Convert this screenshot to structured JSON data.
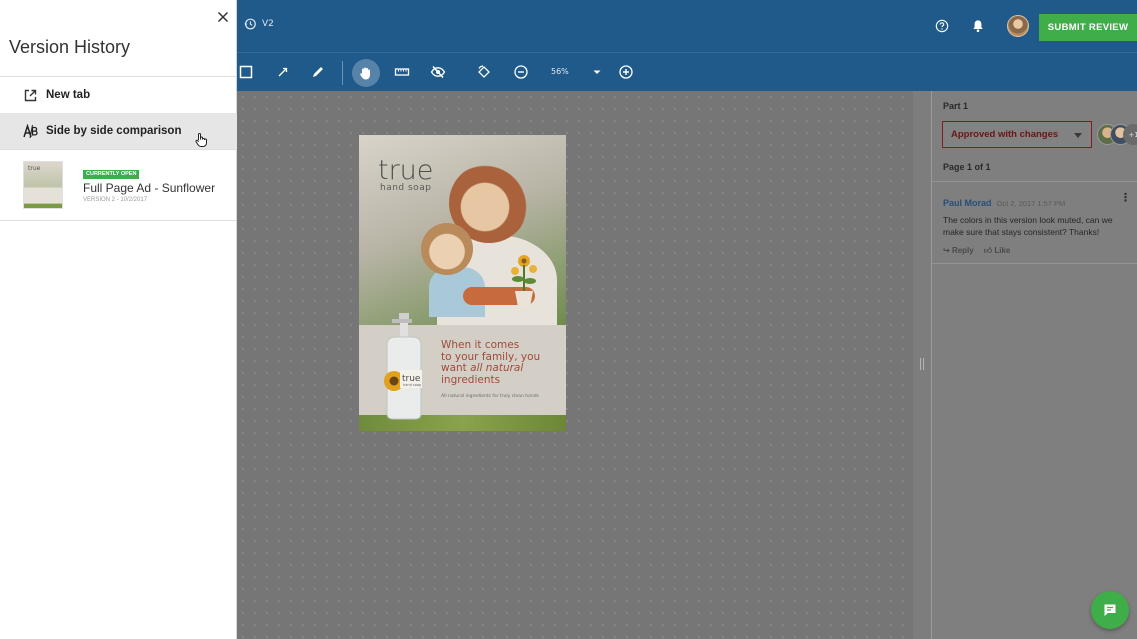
{
  "header": {
    "version_label": "V2",
    "submit_label": "SUBMIT REVIEW"
  },
  "toolbar": {
    "zoom_level": "56%",
    "tools": [
      "rectangle-tool",
      "arrow-tool",
      "pen-tool",
      "hand-tool",
      "ruler-tool",
      "hide-annotations-tool",
      "rotate-tool",
      "zoom-out",
      "zoom-in"
    ],
    "active_tool": "hand-tool"
  },
  "ad": {
    "brand": "true",
    "brand_sub": "hand soap",
    "tagline_line1": "When it comes",
    "tagline_line2": "to your family, you",
    "tagline_want": "want ",
    "tagline_em": "all natural",
    "tagline_line4": "ingredients",
    "fine_print": "All natural ingredients for truly clean hands",
    "bottle_brand": "true",
    "bottle_sub": "hand soap"
  },
  "review_panel": {
    "part_label": "Part 1",
    "status": "Approved with changes",
    "extra_reviewers": "+1",
    "page_label": "Page 1 of 1",
    "comment": {
      "author": "Paul Morad",
      "time": "Oct 2, 2017 1:57 PM",
      "text": "The colors in this version look muted, can we make sure that stays consistent? Thanks!",
      "reply_label": "Reply",
      "like_label": "Like"
    }
  },
  "drawer": {
    "title": "Version History",
    "menu": [
      {
        "label": "New tab",
        "icon": "external-link-icon"
      },
      {
        "label": "Side by side comparison",
        "icon": "compare-icon"
      }
    ],
    "version": {
      "badge": "CURRENTLY OPEN",
      "name": "Full Page Ad - Sunflower",
      "meta": "VERSION 2 - 10/2/2017",
      "thumb_word": "true"
    }
  },
  "colors": {
    "header_blue": "#1f5a8b",
    "accent_green": "#3fae49",
    "status_red": "#7f1e1e",
    "comment_author": "#24507a"
  }
}
